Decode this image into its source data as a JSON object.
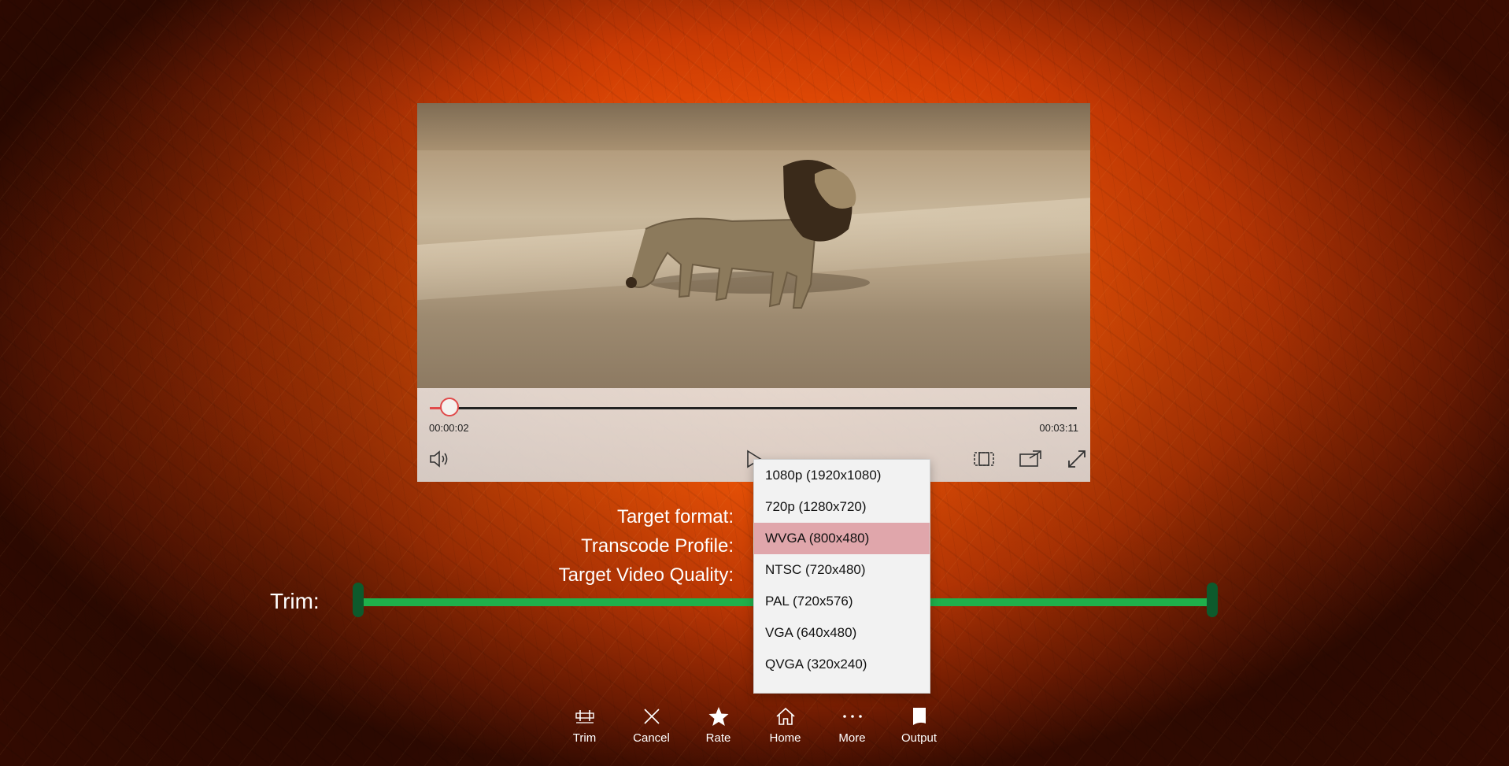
{
  "player": {
    "current_time": "00:00:02",
    "total_time": "00:03:11",
    "progress": 0.03,
    "icons": [
      "volume-icon",
      "play-icon",
      "aspect-ratio-icon",
      "cast-icon",
      "fullscreen-icon"
    ]
  },
  "form": {
    "target_format_label": "Target format:",
    "transcode_profile_label": "Transcode Profile:",
    "target_video_quality_label": "Target Video Quality:",
    "trim_label": "Trim:"
  },
  "dropdown": {
    "options": [
      "1080p (1920x1080)",
      "720p (1280x720)",
      "WVGA (800x480)",
      "NTSC (720x480)",
      "PAL (720x576)",
      "VGA (640x480)",
      "QVGA (320x240)"
    ],
    "selected": "WVGA (800x480)"
  },
  "appbar": {
    "buttons": [
      {
        "label": "Trim",
        "icon": "trim-icon"
      },
      {
        "label": "Cancel",
        "icon": "close-icon"
      },
      {
        "label": "Rate",
        "icon": "star-icon"
      },
      {
        "label": "Home",
        "icon": "home-icon"
      },
      {
        "label": "More",
        "icon": "more-icon"
      },
      {
        "label": "Output",
        "icon": "document-icon"
      }
    ]
  },
  "colors": {
    "accent": "#e04a4a",
    "trim_bar": "#1fb04b",
    "selected_item": "#e0a6ab"
  }
}
